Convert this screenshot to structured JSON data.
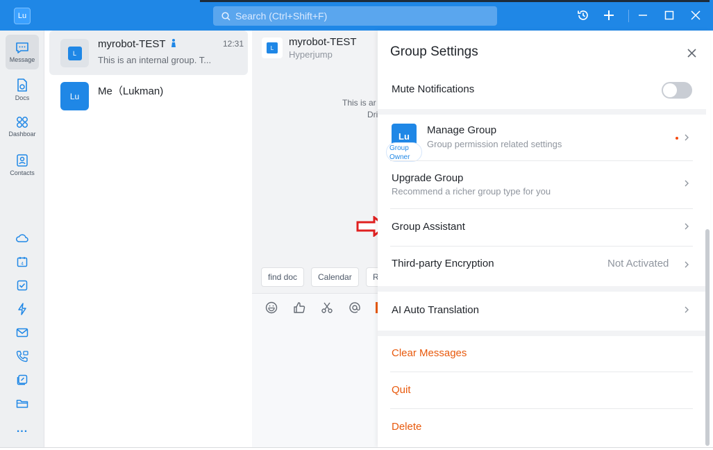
{
  "app": {
    "user_initials": "Lu",
    "search_placeholder": "Search (Ctrl+Shift+F)"
  },
  "leftnav": {
    "items": [
      {
        "label": "Message",
        "icon": "message-icon"
      },
      {
        "label": "Docs",
        "icon": "docs-icon"
      },
      {
        "label": "Dashboar",
        "icon": "dashboard-icon"
      },
      {
        "label": "Contacts",
        "icon": "contacts-icon"
      }
    ],
    "more": "..."
  },
  "chatlist": {
    "items": [
      {
        "avatar": "L",
        "title": "myrobot-TEST",
        "subtitle": "This is an internal group. T...",
        "time": "12:31"
      },
      {
        "avatar": "Lu",
        "title": "Me（Lukman)",
        "subtitle": "",
        "time": ""
      }
    ]
  },
  "chat": {
    "title": "myrobot-TEST",
    "subtitle": "Hyperjump",
    "avatar": "L",
    "notice_line1": "This is ar",
    "notice_line2": "Dri",
    "quick_actions": [
      "find doc",
      "Calendar",
      "R"
    ]
  },
  "settings": {
    "title": "Group Settings",
    "mute_label": "Mute Notifications",
    "mute_on": false,
    "group_avatar": "Lu",
    "owner_badge_line1": "Group",
    "owner_badge_line2": "Owner",
    "manage_label": "Manage Group",
    "manage_sub": "Group permission related settings",
    "upgrade_label": "Upgrade Group",
    "upgrade_sub": "Recommend a richer group type for you",
    "assistant_label": "Group Assistant",
    "encryption_label": "Third-party Encryption",
    "encryption_status": "Not Activated",
    "translation_label": "AI Auto Translation",
    "clear_label": "Clear Messages",
    "quit_label": "Quit",
    "delete_label": "Delete"
  },
  "colors": {
    "brand": "#1f87e6",
    "danger": "#e8590c",
    "annotation_arrow": "#e02020"
  }
}
